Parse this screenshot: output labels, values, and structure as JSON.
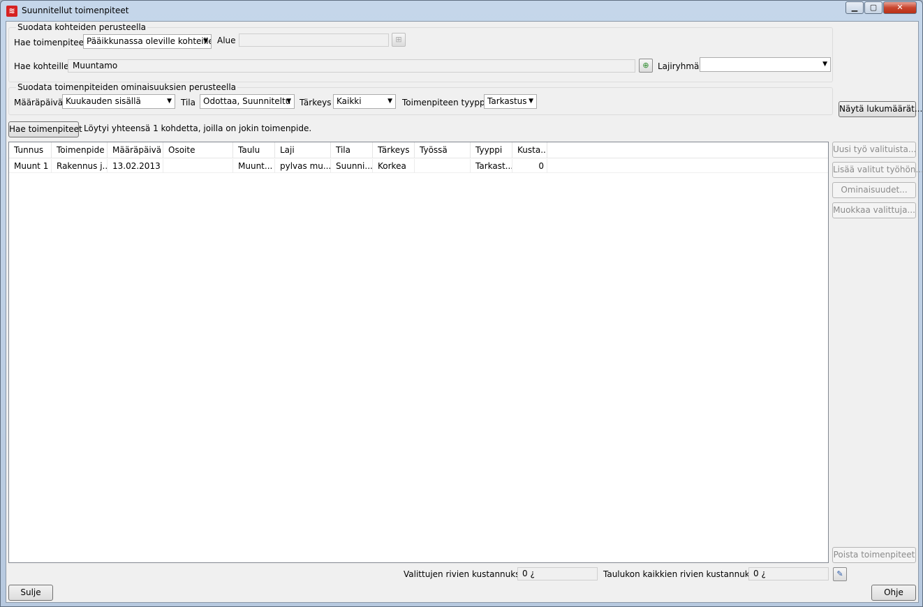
{
  "window": {
    "title": "Suunnitellut toimenpiteet",
    "controls": [
      "minimize-icon",
      "maximize-icon",
      "close-icon"
    ]
  },
  "filter_targets": {
    "group_title": "Suodata kohteiden perusteella",
    "search_label": "Hae toimenpiteet",
    "search_value": "Pääikkunassa oleville kohteille",
    "area_label": "Alue",
    "area_value": "",
    "targets_label": "Hae kohteille",
    "targets_value": "Muuntamo",
    "species_group_label": "Lajiryhmä",
    "species_group_value": ""
  },
  "filter_properties": {
    "group_title": "Suodata toimenpiteiden ominaisuuksien perusteella",
    "due_label": "Määräpäivä",
    "due_value": "Kuukauden sisällä",
    "state_label": "Tila",
    "state_value": "Odottaa, Suunniteltu",
    "priority_label": "Tärkeys",
    "priority_value": "Kaikki",
    "type_label": "Toimenpiteen tyyppi",
    "type_value": "Tarkastus"
  },
  "buttons": {
    "show_counts": "Näytä lukumäärät...",
    "search": "Hae toimenpiteet",
    "new_work": "Uusi työ valituista...",
    "add_to_work": "Lisää valitut työhön...",
    "properties": "Ominaisuudet...",
    "edit_selected": "Muokkaa valittuja...",
    "delete": "Poista toimenpiteet",
    "close": "Sulje",
    "help": "Ohje"
  },
  "result_text": "Löytyi yhteensä 1 kohdetta, joilla on jokin toimenpide.",
  "table": {
    "columns": [
      "Tunnus",
      "Toimenpide",
      "Määräpäivä",
      "Osoite",
      "Taulu",
      "Laji",
      "Tila",
      "Tärkeys",
      "Työssä",
      "Tyyppi",
      "Kusta..."
    ],
    "rows": [
      [
        "Muunt 1",
        "Rakennus j...",
        "13.02.2013",
        "",
        "Muunt...",
        "pylvas mu...",
        "Suunni...",
        "Korkea",
        "",
        "Tarkast...",
        "0"
      ]
    ]
  },
  "footer": {
    "selected_cost_label": "Valittujen rivien kustannukset",
    "selected_cost_value": "0 ¿",
    "all_cost_label": "Taulukon kaikkien rivien kustannukset",
    "all_cost_value": "0 ¿"
  }
}
